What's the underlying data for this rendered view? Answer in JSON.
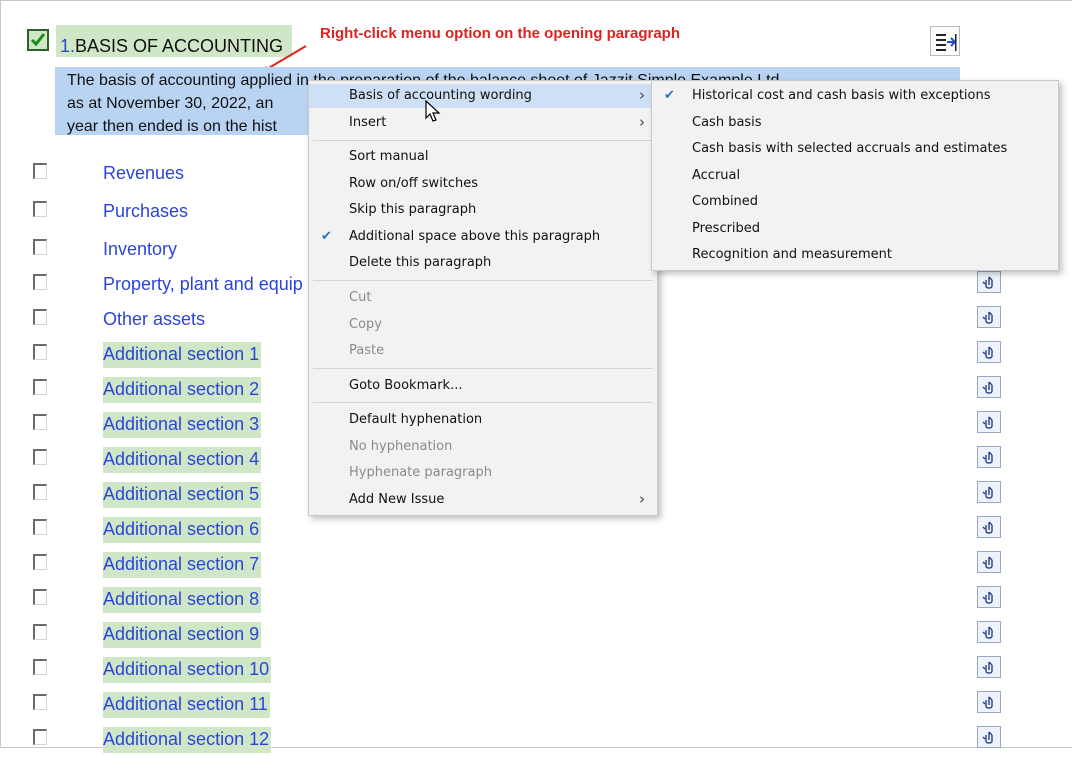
{
  "header": {
    "number": "1.",
    "title": "BASIS OF ACCOUNTING",
    "checked": true,
    "annotation": "Right-click menu option on the opening paragraph"
  },
  "paragraph": {
    "lines": [
      "The basis of accounting applied in the preparation of the balance sheet of Jazzit Simple Example Ltd",
      "as at November 30, 2022, an",
      "year then ended is on the hist"
    ]
  },
  "sections": [
    {
      "label": "Revenues",
      "highlighted": false
    },
    {
      "label": "Purchases",
      "highlighted": false
    },
    {
      "label": "Inventory",
      "highlighted": false
    },
    {
      "label": "Property, plant and equip",
      "highlighted": false
    },
    {
      "label": "Other assets",
      "highlighted": false
    },
    {
      "label": "Additional section 1",
      "highlighted": true
    },
    {
      "label": "Additional section 2",
      "highlighted": true
    },
    {
      "label": "Additional section 3",
      "highlighted": true
    },
    {
      "label": "Additional section 4",
      "highlighted": true
    },
    {
      "label": "Additional section 5",
      "highlighted": true
    },
    {
      "label": "Additional section 6",
      "highlighted": true
    },
    {
      "label": "Additional section 7",
      "highlighted": true
    },
    {
      "label": "Additional section 8",
      "highlighted": true
    },
    {
      "label": "Additional section 9",
      "highlighted": true
    },
    {
      "label": "Additional section 10",
      "highlighted": true
    },
    {
      "label": "Additional section 11",
      "highlighted": true
    },
    {
      "label": "Additional section 12",
      "highlighted": true
    }
  ],
  "context_menu": {
    "items": [
      {
        "label": "Basis of accounting wording",
        "submenu": true,
        "active": true
      },
      {
        "label": "Insert",
        "submenu": true
      },
      {
        "label": "Sort manual"
      },
      {
        "label": "Row on/off switches"
      },
      {
        "label": "Skip this paragraph"
      },
      {
        "label": "Additional space above this paragraph",
        "checked": true
      },
      {
        "label": "Delete this paragraph"
      },
      {
        "label": "Cut",
        "disabled": true
      },
      {
        "label": "Copy",
        "disabled": true
      },
      {
        "label": "Paste",
        "disabled": true
      },
      {
        "label": "Goto Bookmark..."
      },
      {
        "label": "Default hyphenation"
      },
      {
        "label": "No hyphenation",
        "disabled": true
      },
      {
        "label": "Hyphenate paragraph",
        "disabled": true
      },
      {
        "label": "Add New Issue",
        "submenu": true
      }
    ]
  },
  "submenu": {
    "items": [
      {
        "label": "Historical cost and cash basis with exceptions",
        "checked": true
      },
      {
        "label": "Cash basis"
      },
      {
        "label": "Cash basis with selected accruals and estimates"
      },
      {
        "label": "Accrual"
      },
      {
        "label": "Combined"
      },
      {
        "label": "Prescribed"
      },
      {
        "label": "Recognition and measurement"
      }
    ]
  },
  "colors": {
    "section_link": "#2b45d8",
    "highlight_green": "#cfe6c7",
    "paragraph_selection": "#b9d4f2",
    "annotation_red": "#e0221f",
    "menu_hover": "#cde0f6"
  }
}
